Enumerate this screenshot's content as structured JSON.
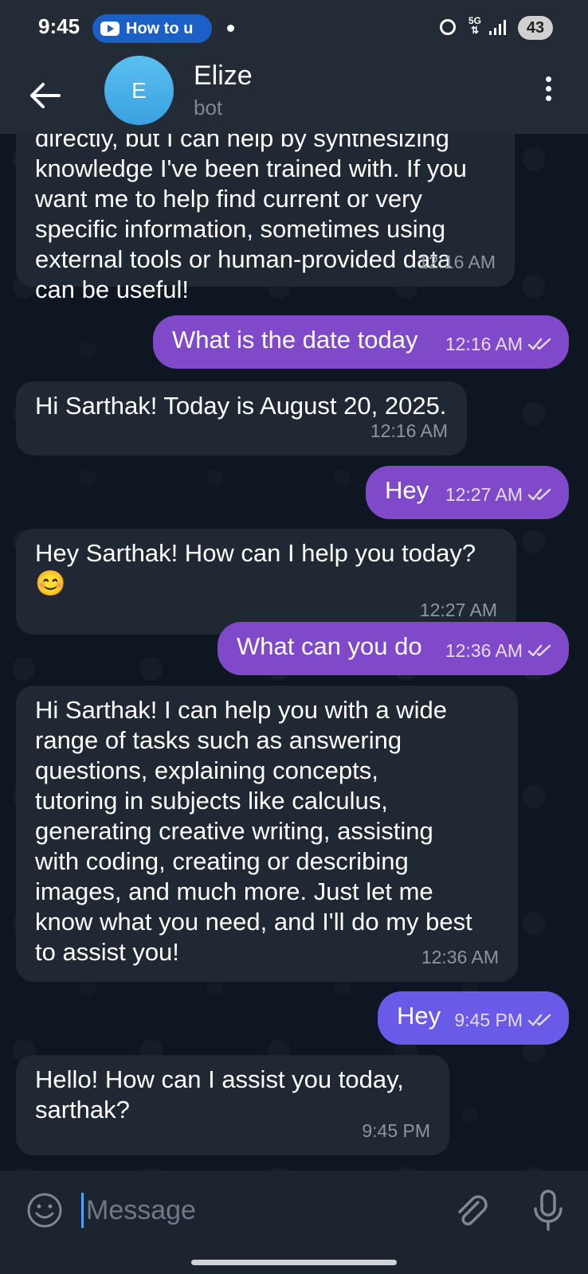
{
  "status_bar": {
    "time": "9:45",
    "pill_text": "How to u",
    "network": "5G",
    "battery": "43"
  },
  "header": {
    "avatar_letter": "E",
    "name": "Elize",
    "status": "bot"
  },
  "messages": [
    {
      "direction": "in",
      "text": "directly, but I can help by synthesizing\nknowledge I've been trained with. If you\nwant me to help find current or very\nspecific information, sometimes using\nexternal tools or human-provided data\ncan be useful!",
      "time": "12:16 AM"
    },
    {
      "direction": "out",
      "text": "What is the date today",
      "time": "12:16 AM",
      "read": true
    },
    {
      "direction": "in",
      "text": "Hi Sarthak! Today is August 20, 2025.",
      "time": "12:16 AM"
    },
    {
      "direction": "out",
      "text": "Hey",
      "time": "12:27 AM",
      "read": true
    },
    {
      "direction": "in",
      "text": "Hey Sarthak! How can I help you today?\n😊",
      "time": "12:27 AM"
    },
    {
      "direction": "out",
      "text": "What can you do",
      "time": "12:36 AM",
      "read": true
    },
    {
      "direction": "in",
      "text": "Hi Sarthak! I can help you with a wide\nrange of tasks such as answering\nquestions, explaining concepts,\ntutoring in subjects like calculus,\ngenerating creative writing, assisting\nwith coding, creating or describing\nimages, and much more. Just let me\nknow what you need, and I'll do my best\nto assist you!",
      "time": "12:36 AM"
    },
    {
      "direction": "out",
      "text": "Hey",
      "time": "9:45 PM",
      "read": true
    },
    {
      "direction": "in",
      "text": "Hello! How can I assist you today,\nsarthak?",
      "time": "9:45 PM"
    }
  ],
  "composer": {
    "placeholder": "Message"
  },
  "colors": {
    "background": "#0e1621",
    "header": "#222b36",
    "incoming_bubble": "#1f2833",
    "outgoing_bubble": "#8049c9",
    "accent": "#4ea4f6"
  }
}
